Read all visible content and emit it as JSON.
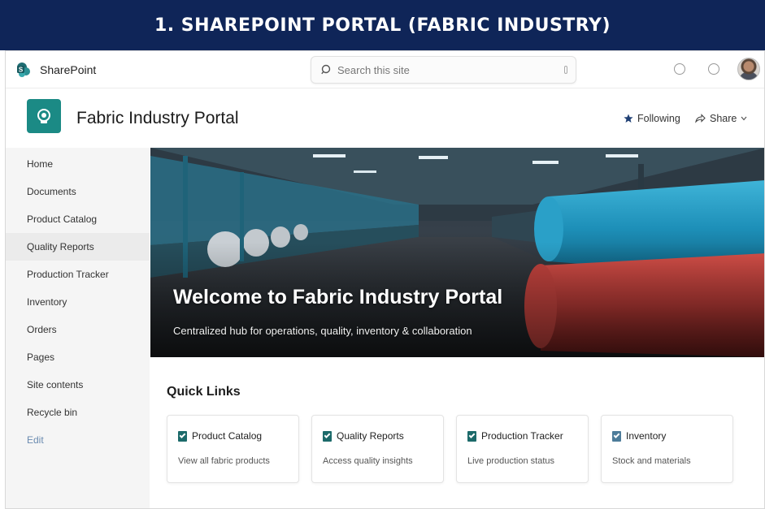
{
  "banner": {
    "title": "1. SHAREPOINT PORTAL (FABRIC INDUSTRY)"
  },
  "suitebar": {
    "brand": "SharePoint",
    "search_placeholder": "Search this site"
  },
  "site": {
    "title": "Fabric Industry Portal",
    "following_label": "Following",
    "share_label": "Share"
  },
  "nav": {
    "items": [
      {
        "label": "Home"
      },
      {
        "label": "Documents"
      },
      {
        "label": "Product Catalog"
      },
      {
        "label": "Quality Reports"
      },
      {
        "label": "Production Tracker"
      },
      {
        "label": "Inventory"
      },
      {
        "label": "Orders"
      },
      {
        "label": "Pages"
      },
      {
        "label": "Site contents"
      },
      {
        "label": "Recycle bin"
      },
      {
        "label": "Edit"
      }
    ],
    "selected": "Quality Reports"
  },
  "hero": {
    "title": "Welcome to Fabric Industry Portal",
    "subtitle": "Centralized hub for operations, quality, inventory & collaboration"
  },
  "quick_links": {
    "title": "Quick Links",
    "cards": [
      {
        "title": "Product Catalog",
        "description": "View all fabric products"
      },
      {
        "title": "Quality Reports",
        "description": "Access quality insights"
      },
      {
        "title": "Production Tracker",
        "description": "Live production status"
      },
      {
        "title": "Inventory",
        "description": "Stock and materials"
      }
    ]
  },
  "colors": {
    "banner": "#0f2558",
    "site_logo": "#1b8a85",
    "teal_roll": "#1f8fb8",
    "red_roll": "#b63a36"
  },
  "icons": [
    "sharepoint-logo-icon",
    "search-icon",
    "settings-icon",
    "help-icon",
    "star-icon",
    "share-icon",
    "chevron-down-icon",
    "document-check-icon"
  ]
}
